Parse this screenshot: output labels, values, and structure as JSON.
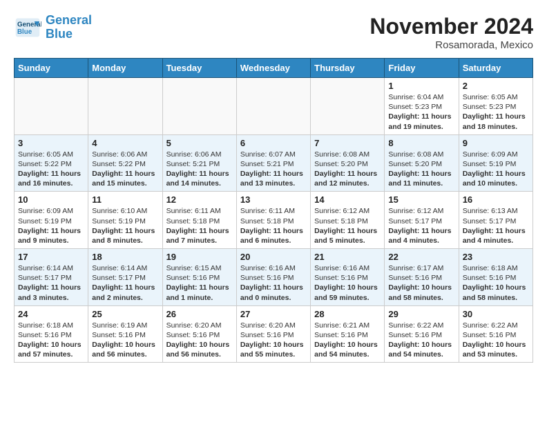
{
  "header": {
    "logo_line1": "General",
    "logo_line2": "Blue",
    "month": "November 2024",
    "location": "Rosamorada, Mexico"
  },
  "weekdays": [
    "Sunday",
    "Monday",
    "Tuesday",
    "Wednesday",
    "Thursday",
    "Friday",
    "Saturday"
  ],
  "weeks": [
    [
      {
        "day": "",
        "detail": ""
      },
      {
        "day": "",
        "detail": ""
      },
      {
        "day": "",
        "detail": ""
      },
      {
        "day": "",
        "detail": ""
      },
      {
        "day": "",
        "detail": ""
      },
      {
        "day": "1",
        "detail": "Sunrise: 6:04 AM\nSunset: 5:23 PM\nDaylight: 11 hours and 19 minutes."
      },
      {
        "day": "2",
        "detail": "Sunrise: 6:05 AM\nSunset: 5:23 PM\nDaylight: 11 hours and 18 minutes."
      }
    ],
    [
      {
        "day": "3",
        "detail": "Sunrise: 6:05 AM\nSunset: 5:22 PM\nDaylight: 11 hours and 16 minutes."
      },
      {
        "day": "4",
        "detail": "Sunrise: 6:06 AM\nSunset: 5:22 PM\nDaylight: 11 hours and 15 minutes."
      },
      {
        "day": "5",
        "detail": "Sunrise: 6:06 AM\nSunset: 5:21 PM\nDaylight: 11 hours and 14 minutes."
      },
      {
        "day": "6",
        "detail": "Sunrise: 6:07 AM\nSunset: 5:21 PM\nDaylight: 11 hours and 13 minutes."
      },
      {
        "day": "7",
        "detail": "Sunrise: 6:08 AM\nSunset: 5:20 PM\nDaylight: 11 hours and 12 minutes."
      },
      {
        "day": "8",
        "detail": "Sunrise: 6:08 AM\nSunset: 5:20 PM\nDaylight: 11 hours and 11 minutes."
      },
      {
        "day": "9",
        "detail": "Sunrise: 6:09 AM\nSunset: 5:19 PM\nDaylight: 11 hours and 10 minutes."
      }
    ],
    [
      {
        "day": "10",
        "detail": "Sunrise: 6:09 AM\nSunset: 5:19 PM\nDaylight: 11 hours and 9 minutes."
      },
      {
        "day": "11",
        "detail": "Sunrise: 6:10 AM\nSunset: 5:19 PM\nDaylight: 11 hours and 8 minutes."
      },
      {
        "day": "12",
        "detail": "Sunrise: 6:11 AM\nSunset: 5:18 PM\nDaylight: 11 hours and 7 minutes."
      },
      {
        "day": "13",
        "detail": "Sunrise: 6:11 AM\nSunset: 5:18 PM\nDaylight: 11 hours and 6 minutes."
      },
      {
        "day": "14",
        "detail": "Sunrise: 6:12 AM\nSunset: 5:18 PM\nDaylight: 11 hours and 5 minutes."
      },
      {
        "day": "15",
        "detail": "Sunrise: 6:12 AM\nSunset: 5:17 PM\nDaylight: 11 hours and 4 minutes."
      },
      {
        "day": "16",
        "detail": "Sunrise: 6:13 AM\nSunset: 5:17 PM\nDaylight: 11 hours and 4 minutes."
      }
    ],
    [
      {
        "day": "17",
        "detail": "Sunrise: 6:14 AM\nSunset: 5:17 PM\nDaylight: 11 hours and 3 minutes."
      },
      {
        "day": "18",
        "detail": "Sunrise: 6:14 AM\nSunset: 5:17 PM\nDaylight: 11 hours and 2 minutes."
      },
      {
        "day": "19",
        "detail": "Sunrise: 6:15 AM\nSunset: 5:16 PM\nDaylight: 11 hours and 1 minute."
      },
      {
        "day": "20",
        "detail": "Sunrise: 6:16 AM\nSunset: 5:16 PM\nDaylight: 11 hours and 0 minutes."
      },
      {
        "day": "21",
        "detail": "Sunrise: 6:16 AM\nSunset: 5:16 PM\nDaylight: 10 hours and 59 minutes."
      },
      {
        "day": "22",
        "detail": "Sunrise: 6:17 AM\nSunset: 5:16 PM\nDaylight: 10 hours and 58 minutes."
      },
      {
        "day": "23",
        "detail": "Sunrise: 6:18 AM\nSunset: 5:16 PM\nDaylight: 10 hours and 58 minutes."
      }
    ],
    [
      {
        "day": "24",
        "detail": "Sunrise: 6:18 AM\nSunset: 5:16 PM\nDaylight: 10 hours and 57 minutes."
      },
      {
        "day": "25",
        "detail": "Sunrise: 6:19 AM\nSunset: 5:16 PM\nDaylight: 10 hours and 56 minutes."
      },
      {
        "day": "26",
        "detail": "Sunrise: 6:20 AM\nSunset: 5:16 PM\nDaylight: 10 hours and 56 minutes."
      },
      {
        "day": "27",
        "detail": "Sunrise: 6:20 AM\nSunset: 5:16 PM\nDaylight: 10 hours and 55 minutes."
      },
      {
        "day": "28",
        "detail": "Sunrise: 6:21 AM\nSunset: 5:16 PM\nDaylight: 10 hours and 54 minutes."
      },
      {
        "day": "29",
        "detail": "Sunrise: 6:22 AM\nSunset: 5:16 PM\nDaylight: 10 hours and 54 minutes."
      },
      {
        "day": "30",
        "detail": "Sunrise: 6:22 AM\nSunset: 5:16 PM\nDaylight: 10 hours and 53 minutes."
      }
    ]
  ]
}
